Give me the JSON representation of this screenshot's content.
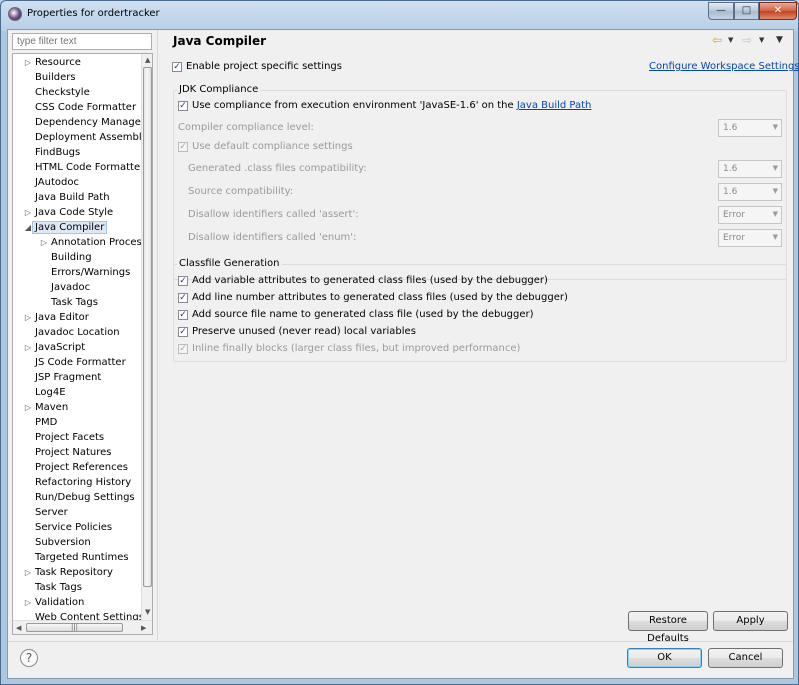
{
  "window": {
    "title": "Properties for ordertracker"
  },
  "filter": {
    "placeholder": "type filter text"
  },
  "tree": {
    "items": [
      {
        "label": "Resource",
        "level": 0,
        "arrow": "right"
      },
      {
        "label": "Builders",
        "level": 0
      },
      {
        "label": "Checkstyle",
        "level": 0
      },
      {
        "label": "CSS Code Formatter",
        "level": 0
      },
      {
        "label": "Dependency Manageme",
        "level": 0
      },
      {
        "label": "Deployment Assembly",
        "level": 0
      },
      {
        "label": "FindBugs",
        "level": 0
      },
      {
        "label": "HTML Code Formatter",
        "level": 0
      },
      {
        "label": "JAutodoc",
        "level": 0
      },
      {
        "label": "Java Build Path",
        "level": 0
      },
      {
        "label": "Java Code Style",
        "level": 0,
        "arrow": "right"
      },
      {
        "label": "Java Compiler",
        "level": 0,
        "arrow": "down",
        "selected": true
      },
      {
        "label": "Annotation Processi",
        "level": 1,
        "arrow": "right"
      },
      {
        "label": "Building",
        "level": 1
      },
      {
        "label": "Errors/Warnings",
        "level": 1
      },
      {
        "label": "Javadoc",
        "level": 1
      },
      {
        "label": "Task Tags",
        "level": 1
      },
      {
        "label": "Java Editor",
        "level": 0,
        "arrow": "right"
      },
      {
        "label": "Javadoc Location",
        "level": 0
      },
      {
        "label": "JavaScript",
        "level": 0,
        "arrow": "right"
      },
      {
        "label": "JS Code Formatter",
        "level": 0
      },
      {
        "label": "JSP Fragment",
        "level": 0
      },
      {
        "label": "Log4E",
        "level": 0
      },
      {
        "label": "Maven",
        "level": 0,
        "arrow": "right"
      },
      {
        "label": "PMD",
        "level": 0
      },
      {
        "label": "Project Facets",
        "level": 0
      },
      {
        "label": "Project Natures",
        "level": 0
      },
      {
        "label": "Project References",
        "level": 0
      },
      {
        "label": "Refactoring History",
        "level": 0
      },
      {
        "label": "Run/Debug Settings",
        "level": 0
      },
      {
        "label": "Server",
        "level": 0
      },
      {
        "label": "Service Policies",
        "level": 0
      },
      {
        "label": "Subversion",
        "level": 0
      },
      {
        "label": "Targeted Runtimes",
        "level": 0
      },
      {
        "label": "Task Repository",
        "level": 0,
        "arrow": "right"
      },
      {
        "label": "Task Tags",
        "level": 0
      },
      {
        "label": "Validation",
        "level": 0,
        "arrow": "right"
      },
      {
        "label": "Web Content Settings",
        "level": 0
      }
    ]
  },
  "page": {
    "title": "Java Compiler",
    "enable_project": "Enable project specific settings",
    "configure_link": "Configure Workspace Settings...",
    "jdk_group": "JDK Compliance",
    "use_compliance_prefix": "Use compliance from execution environment 'JavaSE-1.6' on the ",
    "use_compliance_link": "Java Build Path",
    "compliance_level_label": "Compiler compliance level:",
    "compliance_level_value": "1.6",
    "use_default": "Use default compliance settings",
    "generated_label": "Generated .class files compatibility:",
    "generated_value": "1.6",
    "source_label": "Source compatibility:",
    "source_value": "1.6",
    "assert_label": "Disallow identifiers called 'assert':",
    "assert_value": "Error",
    "enum_label": "Disallow identifiers called 'enum':",
    "enum_value": "Error",
    "classfile_group": "Classfile Generation",
    "opt_variable": "Add variable attributes to generated class files (used by the debugger)",
    "opt_line": "Add line number attributes to generated class files (used by the debugger)",
    "opt_source": "Add source file name to generated class file (used by the debugger)",
    "opt_preserve": "Preserve unused (never read) local variables",
    "opt_inline": "Inline finally blocks (larger class files, but improved performance)"
  },
  "buttons": {
    "restore": "Restore Defaults",
    "apply": "Apply",
    "ok": "OK",
    "cancel": "Cancel"
  },
  "icons": {
    "check": "✓",
    "back": "⇦",
    "forward": "⇨",
    "dropdown": "▼",
    "help": "?"
  },
  "colors": {
    "link": "#0645ad",
    "selection": "#dde8f6"
  }
}
